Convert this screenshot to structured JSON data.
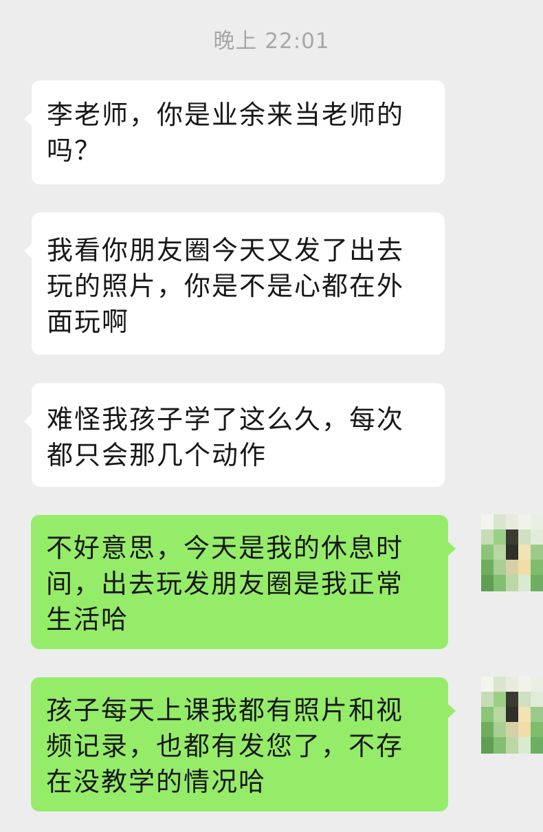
{
  "chat": {
    "timestamp": "晚上 22:01",
    "messages": [
      {
        "sender": "other",
        "lines": [
          "李老师，你是业余来当老师的",
          "吗？"
        ]
      },
      {
        "sender": "other",
        "lines": [
          "我看你朋友圈今天又发了出去",
          "玩的照片，你是不是心都在外",
          "面玩啊"
        ]
      },
      {
        "sender": "other",
        "lines": [
          "难怪我孩子学了这么久，每次",
          "都只会那几个动作"
        ]
      },
      {
        "sender": "self",
        "lines": [
          "不好意思，今天是我的休息时",
          "间，出去玩发朋友圈是我正常",
          "生活哈"
        ]
      },
      {
        "sender": "self",
        "lines": [
          "孩子每天上课我都有照片和视",
          "频记录，也都有发您了，不存",
          "在没教学的情况哈"
        ]
      }
    ]
  },
  "colors": {
    "background": "#ededed",
    "incoming_bubble": "#ffffff",
    "outgoing_bubble": "#95ec69",
    "timestamp_text": "#a8a8a8",
    "message_text": "#181818"
  },
  "icons": {
    "self_avatar": "pixelated-avatar-icon"
  }
}
